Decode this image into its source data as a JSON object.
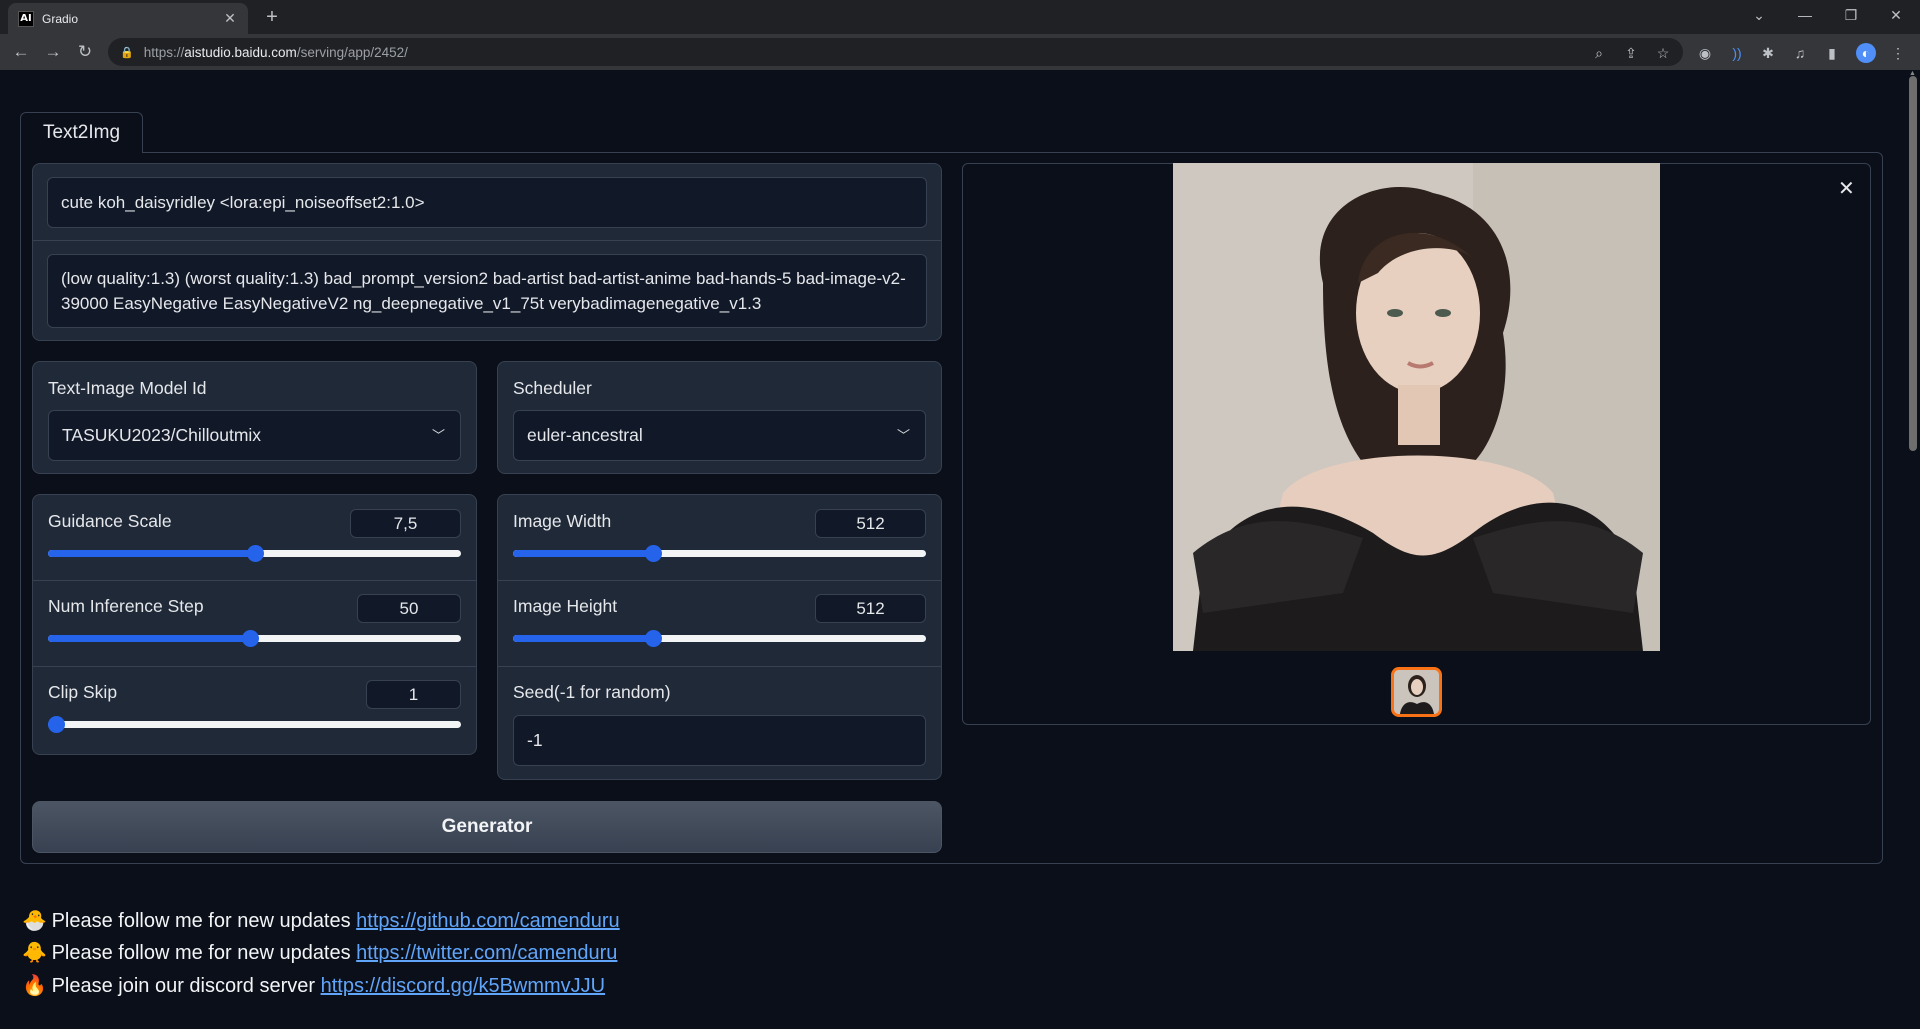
{
  "browser": {
    "tab_title": "Gradio",
    "favicon_text": "AI",
    "url_prefix": "https://",
    "url_domain": "aistudio.baidu.com",
    "url_path": "/serving/app/2452/"
  },
  "tabs": [
    {
      "label": "Text2Img"
    }
  ],
  "prompt": {
    "value": "cute koh_daisyridley <lora:epi_noiseoffset2:1.0>"
  },
  "negative_prompt": {
    "value": "(low quality:1.3) (worst quality:1.3) bad_prompt_version2 bad-artist bad-artist-anime bad-hands-5 bad-image-v2-39000 EasyNegative EasyNegativeV2 ng_deepnegative_v1_75t verybadimagenegative_v1.3"
  },
  "model": {
    "label": "Text-Image Model Id",
    "value": "TASUKU2023/Chilloutmix"
  },
  "scheduler": {
    "label": "Scheduler",
    "value": "euler-ancestral"
  },
  "guidance": {
    "label": "Guidance Scale",
    "value": "7,5",
    "fraction": 0.5
  },
  "steps": {
    "label": "Num Inference Step",
    "value": "50",
    "fraction": 0.49
  },
  "clip_skip": {
    "label": "Clip Skip",
    "value": "1",
    "fraction": 0.0
  },
  "width": {
    "label": "Image Width",
    "value": "512",
    "fraction": 0.34
  },
  "height": {
    "label": "Image Height",
    "value": "512",
    "fraction": 0.34
  },
  "seed": {
    "label": "Seed(-1 for random)",
    "value": "-1"
  },
  "generate_button": {
    "label": "Generator"
  },
  "footer": [
    {
      "emoji": "🐣",
      "text": "Please follow me for new updates ",
      "link": "https://github.com/camenduru"
    },
    {
      "emoji": "🐥",
      "text": "Please follow me for new updates ",
      "link": "https://twitter.com/camenduru"
    },
    {
      "emoji": "🔥",
      "text": "Please join our discord server ",
      "link": "https://discord.gg/k5BwmmvJJU"
    }
  ],
  "colors": {
    "accent": "#2563eb",
    "selected_thumb": "#f97316",
    "background": "#0b0f19",
    "panel": "#1f2937"
  }
}
